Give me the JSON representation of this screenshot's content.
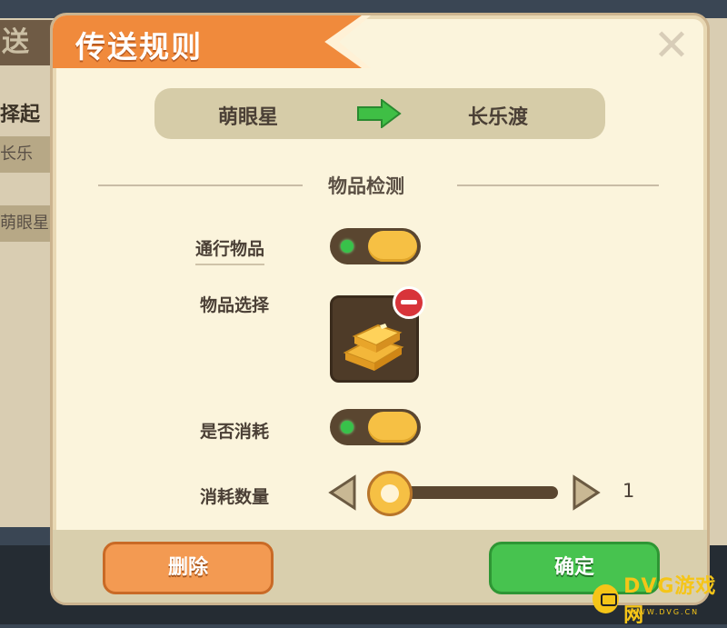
{
  "background": {
    "left_tab": "送",
    "left_label": "择起",
    "left_rows": [
      "长乐",
      "萌眼星"
    ],
    "right_button": "定"
  },
  "dialog": {
    "title": "传送规则",
    "close_icon": "close-x-icon",
    "route": {
      "from": "萌眼星",
      "to": "长乐渡",
      "arrow_icon": "green-arrow-right-icon"
    },
    "section_title": "物品检测",
    "rows": {
      "pass_item_label": "通行物品",
      "pass_item_enabled": true,
      "item_select_label": "物品选择",
      "selected_item_icon": "gold-bars-icon",
      "consume_label": "是否消耗",
      "consume_enabled": true,
      "consume_count_label": "消耗数量",
      "consume_count": "1"
    },
    "buttons": {
      "delete": "删除",
      "confirm": "确定"
    }
  },
  "watermark": {
    "text": "DVG游戏网",
    "sub": "WWW.DVG.CN"
  },
  "colors": {
    "ribbon": "#f08a3c",
    "confirm": "#47c34f",
    "delete": "#f39a52",
    "panel": "#fbf4dc"
  }
}
